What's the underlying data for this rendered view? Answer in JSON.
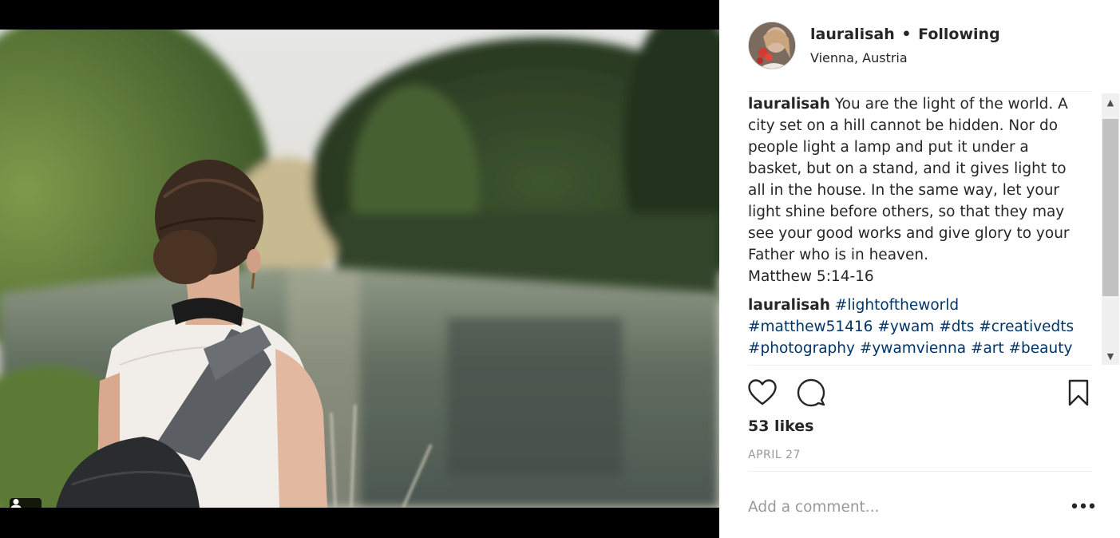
{
  "post": {
    "username": "lauralisah",
    "separator": "•",
    "follow_status": "Following",
    "location": "Vienna, Austria"
  },
  "caption": {
    "username": "lauralisah",
    "text": "You are the light of the world. A city set on a hill cannot be hidden. Nor do people light a lamp and put it under a basket, but on a stand, and it gives light to all in the house. In the same way, let your light shine before others, so that they may see your good works and give glory to your Father who is in heaven.",
    "reference": "Matthew 5:14-16"
  },
  "tags_comment": {
    "username": "lauralisah",
    "hashtags": [
      "#lightoftheworld",
      "#matthew51416",
      "#ywam",
      "#dts",
      "#creativedts",
      "#photography",
      "#ywamvienna",
      "#art",
      "#beauty"
    ]
  },
  "stats": {
    "likes": "53 likes",
    "date": "APRIL 27"
  },
  "comment": {
    "placeholder": "Add a comment..."
  },
  "icons": {
    "like": "heart-icon",
    "comment": "comment-bubble-icon",
    "save": "bookmark-icon",
    "more": "more-options-icon",
    "tagged": "user-silhouette-icon",
    "scroll_up": "▲",
    "scroll_down": "▼",
    "more_glyph": "•••"
  },
  "colors": {
    "hashtag": "#003569",
    "text": "#262626",
    "muted": "#999999"
  }
}
